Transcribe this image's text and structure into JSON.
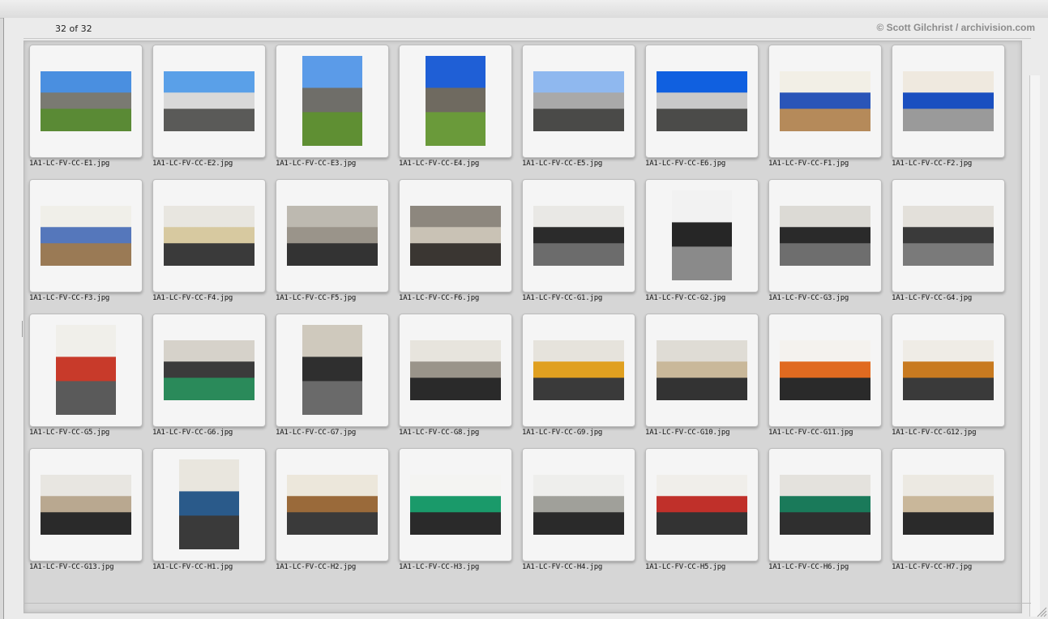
{
  "header": {
    "count_label": "32 of 32",
    "credit": "© Scott Gilchrist / archivision.com"
  },
  "thumbnails": [
    {
      "filename": "1A1-LC-FV-CC-E1.jpg",
      "orientation": "landscape",
      "palette": [
        "#4a8fe0",
        "#7a7a72",
        "#5a8a35"
      ]
    },
    {
      "filename": "1A1-LC-FV-CC-E2.jpg",
      "orientation": "landscape",
      "palette": [
        "#5aa0e8",
        "#d9d9d9",
        "#5a5a58"
      ]
    },
    {
      "filename": "1A1-LC-FV-CC-E3.jpg",
      "orientation": "portrait",
      "palette": [
        "#5b9be8",
        "#6f6e69",
        "#5f8f33"
      ]
    },
    {
      "filename": "1A1-LC-FV-CC-E4.jpg",
      "orientation": "portrait",
      "palette": [
        "#1f5fd6",
        "#6f6a60",
        "#6a9a3a"
      ]
    },
    {
      "filename": "1A1-LC-FV-CC-E5.jpg",
      "orientation": "landscape",
      "palette": [
        "#8fb8ef",
        "#a9a9a9",
        "#4a4a48"
      ]
    },
    {
      "filename": "1A1-LC-FV-CC-E6.jpg",
      "orientation": "landscape",
      "palette": [
        "#1060e0",
        "#c9c9c9",
        "#4b4b49"
      ]
    },
    {
      "filename": "1A1-LC-FV-CC-F1.jpg",
      "orientation": "landscape",
      "palette": [
        "#f2efe6",
        "#2a55b8",
        "#b58a5a"
      ]
    },
    {
      "filename": "1A1-LC-FV-CC-F2.jpg",
      "orientation": "landscape",
      "palette": [
        "#efe9df",
        "#1a4fc0",
        "#9a9a9a"
      ]
    },
    {
      "filename": "1A1-LC-FV-CC-F3.jpg",
      "orientation": "landscape",
      "palette": [
        "#f0efe9",
        "#5577bb",
        "#9a7a55"
      ]
    },
    {
      "filename": "1A1-LC-FV-CC-F4.jpg",
      "orientation": "landscape",
      "palette": [
        "#e8e6e0",
        "#d7c9a0",
        "#3a3a3a"
      ]
    },
    {
      "filename": "1A1-LC-FV-CC-F5.jpg",
      "orientation": "landscape",
      "palette": [
        "#bdb9b0",
        "#9a948a",
        "#333333"
      ]
    },
    {
      "filename": "1A1-LC-FV-CC-F6.jpg",
      "orientation": "landscape",
      "palette": [
        "#8d877e",
        "#c9c2b5",
        "#3a3632"
      ]
    },
    {
      "filename": "1A1-LC-FV-CC-G1.jpg",
      "orientation": "landscape",
      "palette": [
        "#e9e8e5",
        "#2b2b2b",
        "#6c6c6c"
      ]
    },
    {
      "filename": "1A1-LC-FV-CC-G2.jpg",
      "orientation": "portrait",
      "palette": [
        "#f2f2f2",
        "#262626",
        "#8a8a8a"
      ]
    },
    {
      "filename": "1A1-LC-FV-CC-G3.jpg",
      "orientation": "landscape",
      "palette": [
        "#dcdad5",
        "#2a2a2a",
        "#6e6e6e"
      ]
    },
    {
      "filename": "1A1-LC-FV-CC-G4.jpg",
      "orientation": "landscape",
      "palette": [
        "#e3e0da",
        "#3a3a3a",
        "#7a7a7a"
      ]
    },
    {
      "filename": "1A1-LC-FV-CC-G5.jpg",
      "orientation": "portrait",
      "palette": [
        "#f0efea",
        "#c83a2a",
        "#5a5a5a"
      ]
    },
    {
      "filename": "1A1-LC-FV-CC-G6.jpg",
      "orientation": "landscape",
      "palette": [
        "#d6d2ca",
        "#3b3b3b",
        "#2a8a5a"
      ]
    },
    {
      "filename": "1A1-LC-FV-CC-G7.jpg",
      "orientation": "portrait",
      "palette": [
        "#cfc9bd",
        "#2f2f2f",
        "#6a6a6a"
      ]
    },
    {
      "filename": "1A1-LC-FV-CC-G8.jpg",
      "orientation": "landscape",
      "palette": [
        "#e7e4dd",
        "#9a948a",
        "#2a2a2a"
      ]
    },
    {
      "filename": "1A1-LC-FV-CC-G9.jpg",
      "orientation": "landscape",
      "palette": [
        "#e6e3dc",
        "#e0a020",
        "#3a3a3a"
      ]
    },
    {
      "filename": "1A1-LC-FV-CC-G10.jpg",
      "orientation": "landscape",
      "palette": [
        "#dfdcd5",
        "#c9b89a",
        "#333333"
      ]
    },
    {
      "filename": "1A1-LC-FV-CC-G11.jpg",
      "orientation": "landscape",
      "palette": [
        "#f4f2ee",
        "#e06a20",
        "#2a2a2a"
      ]
    },
    {
      "filename": "1A1-LC-FV-CC-G12.jpg",
      "orientation": "landscape",
      "palette": [
        "#efece6",
        "#c87a20",
        "#3a3a3a"
      ]
    },
    {
      "filename": "1A1-LC-FV-CC-G13.jpg",
      "orientation": "landscape",
      "palette": [
        "#e8e6e1",
        "#b9a890",
        "#2a2a2a"
      ]
    },
    {
      "filename": "1A1-LC-FV-CC-H1.jpg",
      "orientation": "portrait",
      "palette": [
        "#e9e6de",
        "#2a5a8a",
        "#3a3a3a"
      ]
    },
    {
      "filename": "1A1-LC-FV-CC-H2.jpg",
      "orientation": "landscape",
      "palette": [
        "#ece7db",
        "#9a6a3a",
        "#3a3a3a"
      ]
    },
    {
      "filename": "1A1-LC-FV-CC-H3.jpg",
      "orientation": "landscape",
      "palette": [
        "#f4f4f2",
        "#1a9a6a",
        "#2a2a2a"
      ]
    },
    {
      "filename": "1A1-LC-FV-CC-H4.jpg",
      "orientation": "landscape",
      "palette": [
        "#eeeeec",
        "#a0a09a",
        "#2a2a2a"
      ]
    },
    {
      "filename": "1A1-LC-FV-CC-H5.jpg",
      "orientation": "landscape",
      "palette": [
        "#f0eeea",
        "#c0302a",
        "#333333"
      ]
    },
    {
      "filename": "1A1-LC-FV-CC-H6.jpg",
      "orientation": "landscape",
      "palette": [
        "#e4e2dd",
        "#1a7a5a",
        "#2f2f2f"
      ]
    },
    {
      "filename": "1A1-LC-FV-CC-H7.jpg",
      "orientation": "landscape",
      "palette": [
        "#ece9e2",
        "#c9b79a",
        "#2a2a2a"
      ]
    }
  ]
}
